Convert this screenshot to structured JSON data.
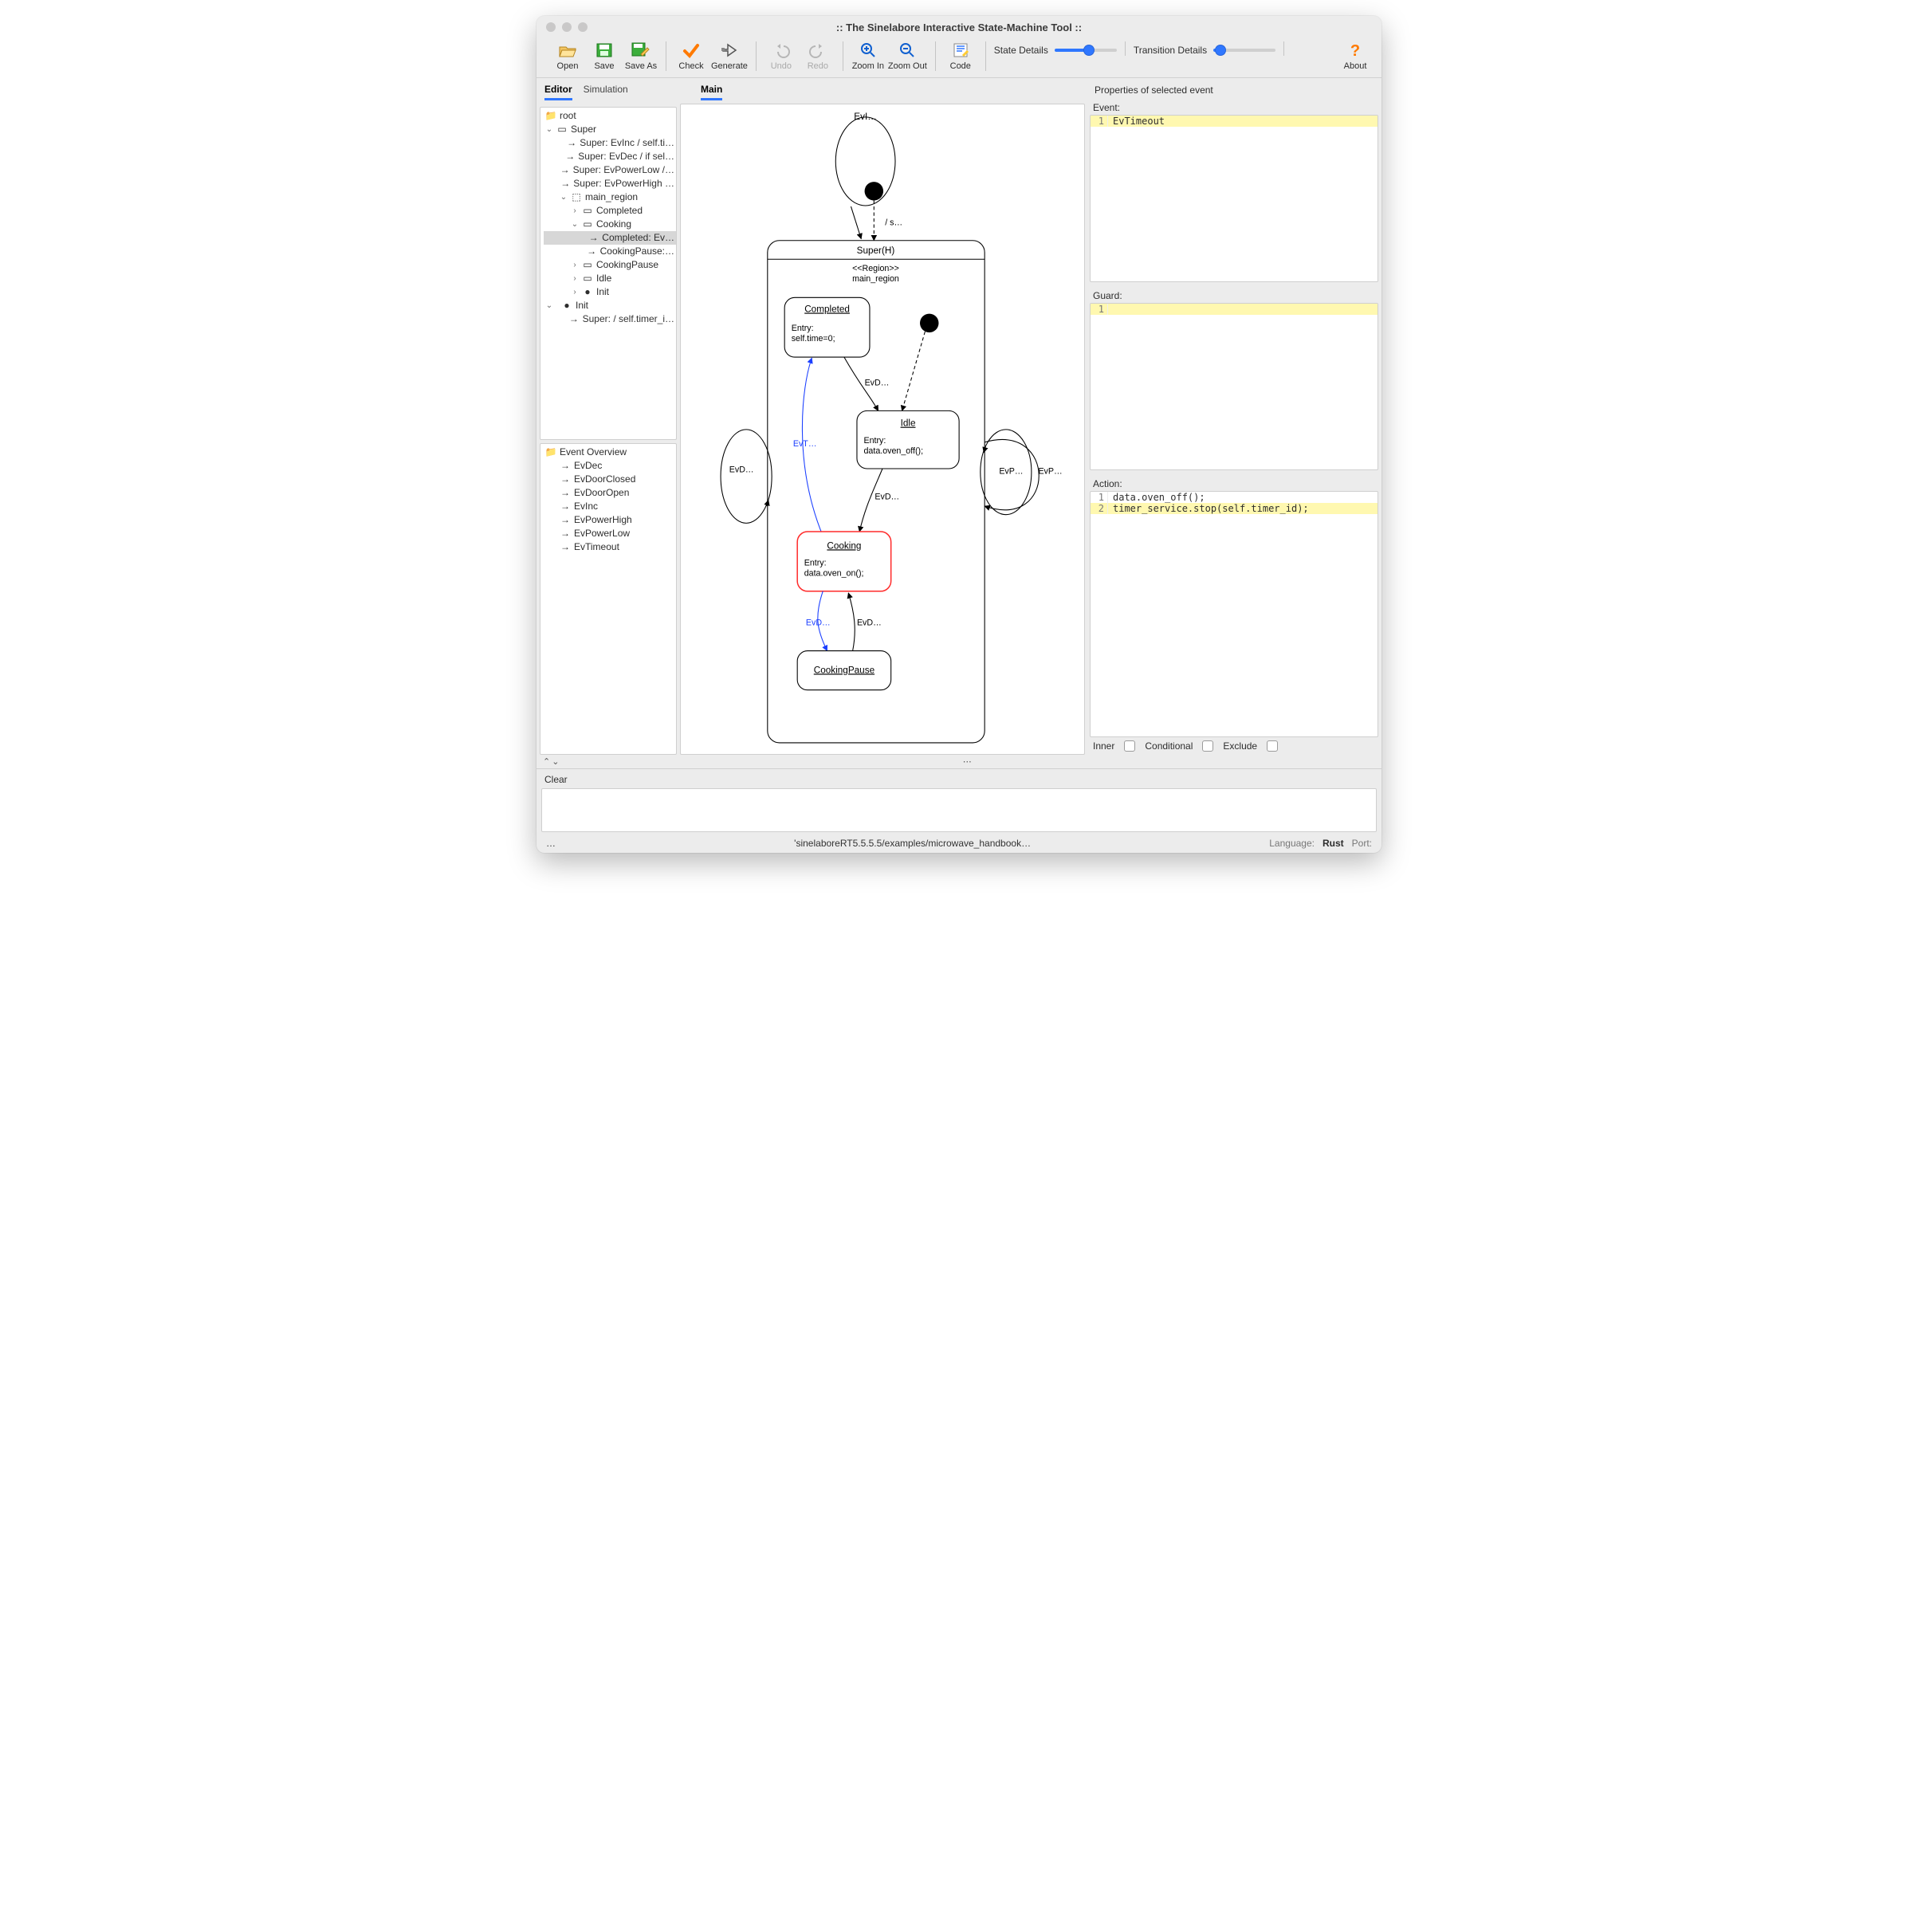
{
  "window": {
    "title": ":: The Sinelabore Interactive State-Machine Tool ::"
  },
  "toolbar": {
    "open": "Open",
    "save": "Save",
    "saveAs": "Save As",
    "check": "Check",
    "generate": "Generate",
    "undo": "Undo",
    "redo": "Redo",
    "zoomIn": "Zoom In",
    "zoomOut": "Zoom Out",
    "code": "Code",
    "stateDetails": "State Details",
    "transitionDetails": "Transition Details",
    "about": "About"
  },
  "left": {
    "tabs": {
      "editor": "Editor",
      "simulation": "Simulation"
    },
    "tree": {
      "root": "root",
      "super": "Super",
      "t1": "Super: EvInc / self.ti…",
      "t2": "Super: EvDec / if sel…",
      "t3": "Super: EvPowerLow /…",
      "t4": "Super: EvPowerHigh …",
      "region": "main_region",
      "completed": "Completed",
      "cooking": "Cooking",
      "cooking_t1": "Completed: Ev…",
      "cooking_t2": "CookingPause:…",
      "cookingPause": "CookingPause",
      "idle": "Idle",
      "init": "Init",
      "rootInit": "Init",
      "superInit": "Super:  / self.timer_i…"
    },
    "eventOverview": {
      "title": "Event Overview",
      "items": [
        "EvDec",
        "EvDoorClosed",
        "EvDoorOpen",
        "EvInc",
        "EvPowerHigh",
        "EvPowerLow",
        "EvTimeout"
      ]
    }
  },
  "canvas": {
    "tab": "Main",
    "topLabel": "EvI…",
    "superTitle": "Super(H)",
    "regionTag": "<<Region>>",
    "regionName": "main_region",
    "completed": {
      "title": "Completed",
      "action": "Entry:\nself.time=0;"
    },
    "idle": {
      "title": "Idle",
      "action": "Entry:\ndata.oven_off();"
    },
    "cooking": {
      "title": "Cooking",
      "action": "Entry:\ndata.oven_on();"
    },
    "cookingPause": {
      "title": "CookingPause"
    },
    "edgeLabels": {
      "init": "/ s…",
      "evd1": "EvD…",
      "evd2": "EvD…",
      "evt": "EvT…",
      "evd3": "EvD…",
      "evd4": "EvD…",
      "evdLeft": "EvD…",
      "evpIn": "EvP…",
      "evpOut": "EvP…"
    }
  },
  "props": {
    "title": "Properties of selected event",
    "eventLabel": "Event:",
    "eventLines": [
      "EvTimeout"
    ],
    "guardLabel": "Guard:",
    "guardLines": [
      ""
    ],
    "actionLabel": "Action:",
    "actionLines": [
      "data.oven_off();",
      "timer_service.stop(self.timer_id);"
    ],
    "inner": "Inner",
    "conditional": "Conditional",
    "exclude": "Exclude"
  },
  "bottom": {
    "clear": "Clear"
  },
  "status": {
    "ellipsis": "…",
    "path": "'sinelaboreRT5.5.5.5/examples/microwave_handbook…",
    "langLabel": "Language:",
    "lang": "Rust",
    "portLabel": "Port:"
  }
}
